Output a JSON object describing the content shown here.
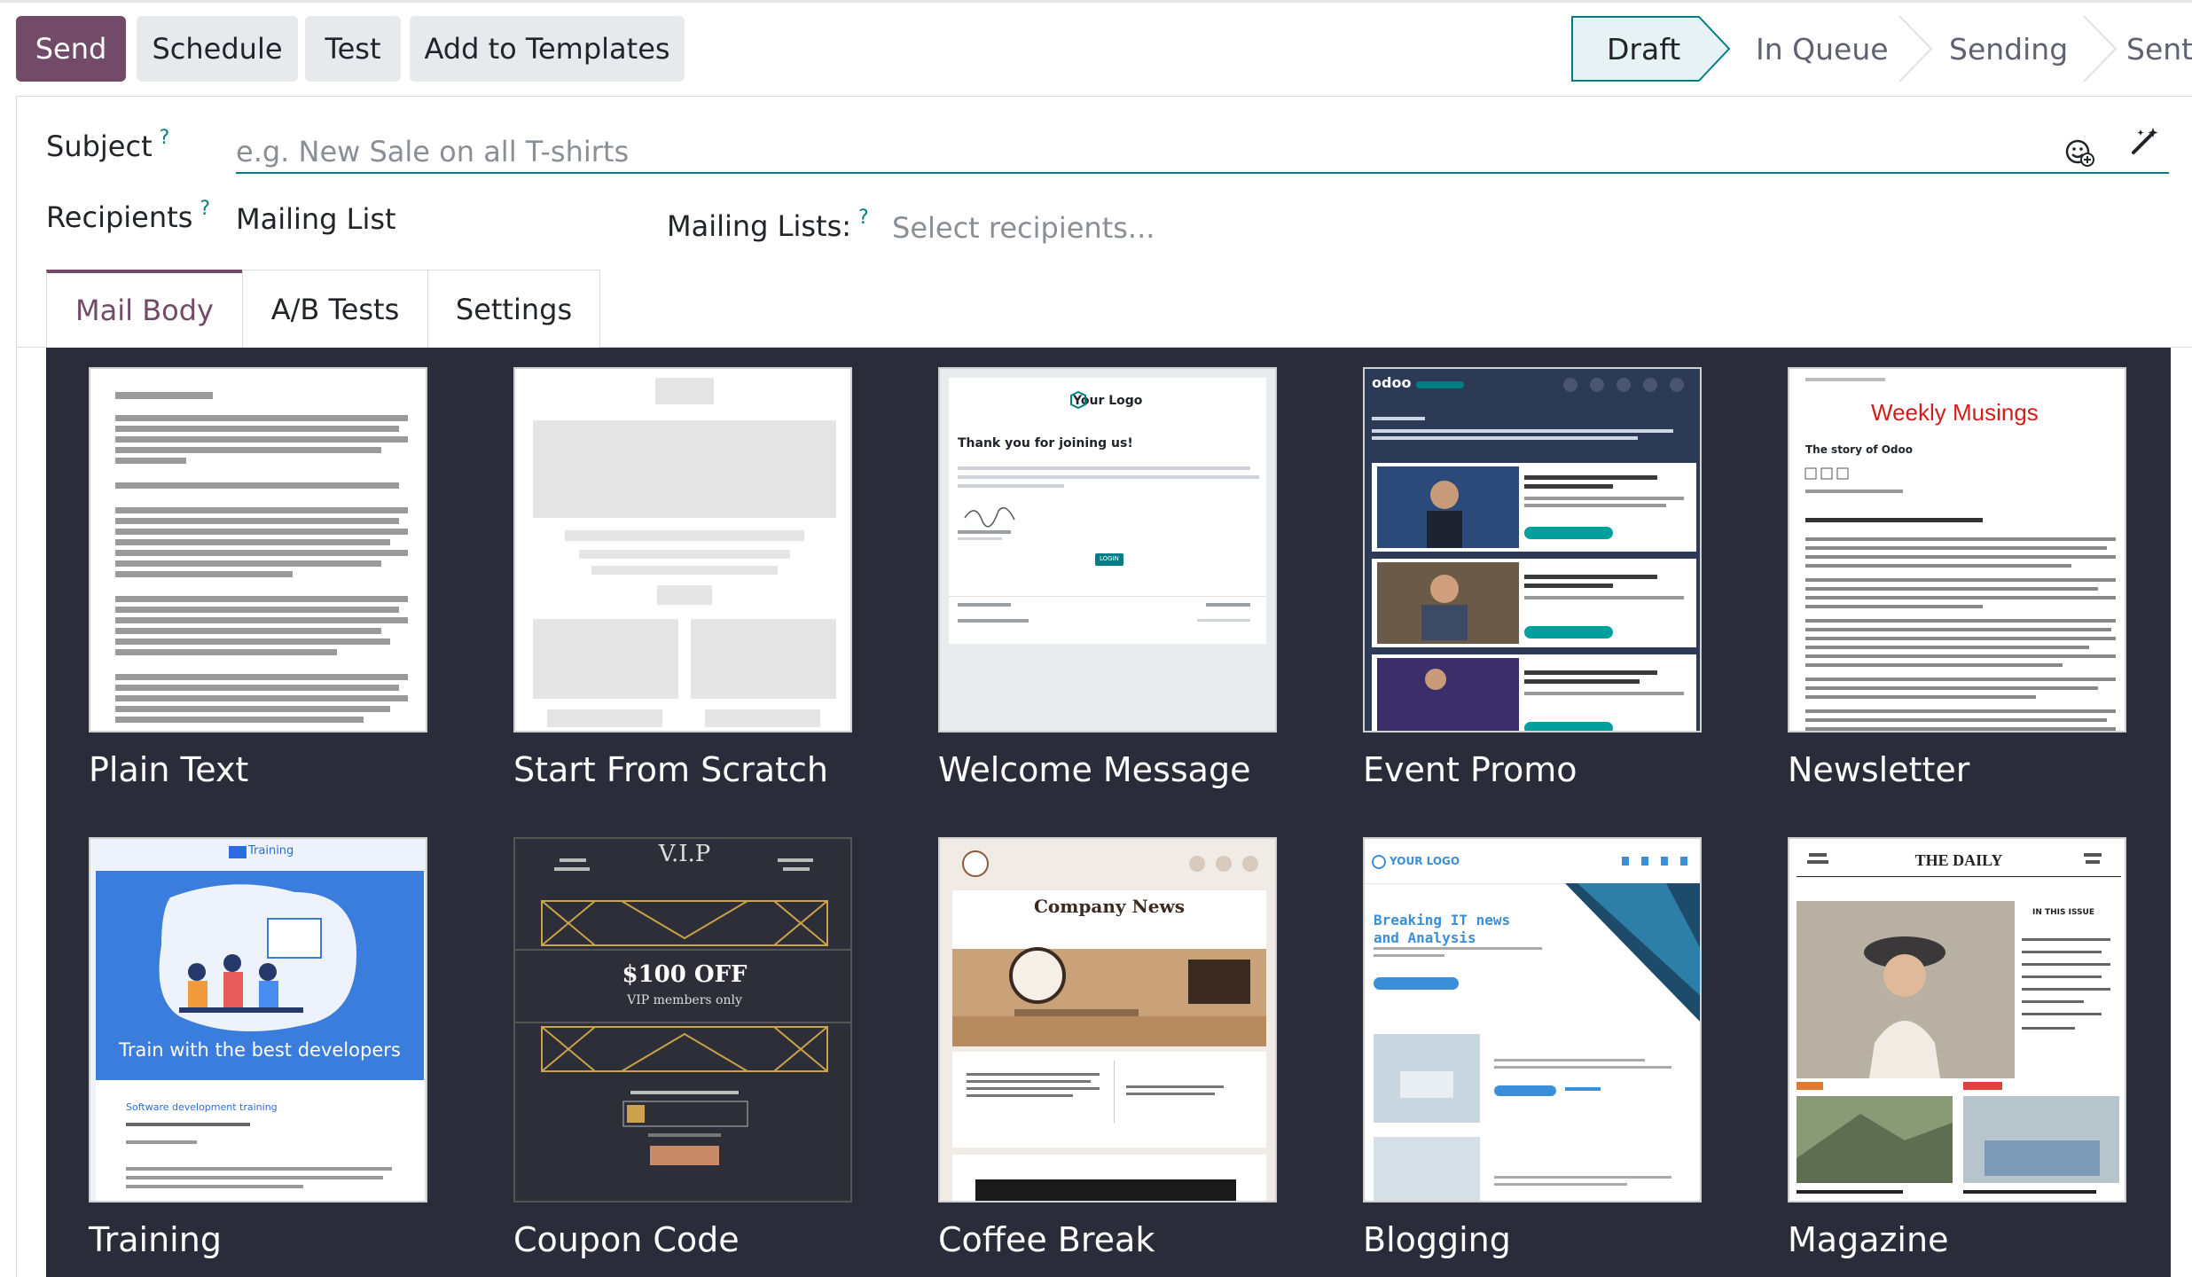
{
  "toolbar": {
    "send_label": "Send",
    "schedule_label": "Schedule",
    "test_label": "Test",
    "add_templates_label": "Add to Templates"
  },
  "statusbar": {
    "stages": [
      {
        "label": "Draft",
        "active": true
      },
      {
        "label": "In Queue",
        "active": false
      },
      {
        "label": "Sending",
        "active": false
      },
      {
        "label": "Sent",
        "active": false
      }
    ]
  },
  "form": {
    "subject_label": "Subject",
    "subject_placeholder": "e.g. New Sale on all T-shirts",
    "recipients_label": "Recipients",
    "recipients_value": "Mailing List",
    "mailing_lists_label": "Mailing Lists:",
    "mailing_lists_placeholder": "Select recipients...",
    "help_mark": "?"
  },
  "tabs": [
    "Mail Body",
    "A/B Tests",
    "Settings"
  ],
  "templates": [
    {
      "name": "Plain Text"
    },
    {
      "name": "Start From Scratch"
    },
    {
      "name": "Welcome Message"
    },
    {
      "name": "Event Promo"
    },
    {
      "name": "Newsletter"
    },
    {
      "name": "Training"
    },
    {
      "name": "Coupon Code"
    },
    {
      "name": "Coffee Break"
    },
    {
      "name": "Blogging"
    },
    {
      "name": "Magazine"
    }
  ],
  "thumb_text": {
    "welcome_logo": "Your Logo",
    "welcome_heading": "Thank you for joining us!",
    "welcome_button": "LOGIN",
    "event_logo": "odoo",
    "newsletter_title": "Weekly Musings",
    "newsletter_subtitle": "The story of Odoo",
    "training_brand": "Training",
    "training_headline": "Train with the best developers",
    "training_course": "Software development training",
    "coupon_title": "V.I.P",
    "coupon_offer": "$100 OFF",
    "coupon_sub": "VIP members only",
    "coffee_title": "Company News",
    "blog_logo": "YOUR LOGO",
    "blog_title_1": "Breaking IT news",
    "blog_title_2": "and Analysis",
    "magazine_title": "THE DAILY",
    "magazine_issue": "IN THIS ISSUE"
  },
  "colors": {
    "brand": "#714b67",
    "accent": "#017e84",
    "gallery_bg": "#2b2c3a"
  }
}
